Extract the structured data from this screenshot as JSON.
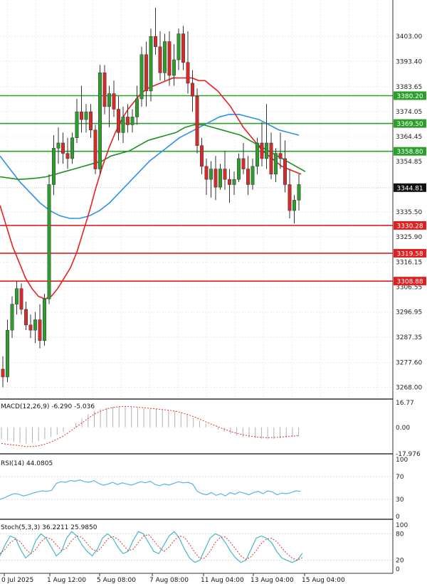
{
  "chart_data": {
    "type": "candlestick",
    "colors": {
      "bull": "#2e9d2e",
      "bear": "#d62b2b",
      "ma_red": "#e82020",
      "ma_green": "#1f8f1f",
      "ma_blue": "#2f8fe6",
      "support": "#e02020",
      "resistance": "#2aa02a",
      "macd_signal": "#e03030",
      "rsi_line": "#5ab0e8",
      "stoch_k": "#42b8c8",
      "stoch_d": "#e03030",
      "current_price": "#111111"
    },
    "price_axis": {
      "ticks": [
        "3403.00",
        "3393.40",
        "3383.65",
        "3374.05",
        "3364.45",
        "3354.85",
        "3335.50",
        "3325.90",
        "3316.15",
        "3306.55",
        "3296.95",
        "3287.35",
        "3277.60",
        "3268.00"
      ],
      "range": [
        3263.5,
        3417
      ]
    },
    "current_price": {
      "label": "3344.81",
      "value": 3344.81
    },
    "levels": [
      {
        "label": "3380.20",
        "value": 3380.2,
        "kind": "resistance"
      },
      {
        "label": "3369.50",
        "value": 3369.5,
        "kind": "resistance"
      },
      {
        "label": "3358.80",
        "value": 3358.8,
        "kind": "resistance"
      },
      {
        "label": "3330.28",
        "value": 3330.28,
        "kind": "support"
      },
      {
        "label": "3319.58",
        "value": 3319.58,
        "kind": "support"
      },
      {
        "label": "3308.88",
        "value": 3308.88,
        "kind": "support"
      }
    ],
    "x_labels": [
      "0 Jul 2025",
      "1 Aug 12:00",
      "5 Aug 08:00",
      "7 Aug 08:00",
      "11 Aug 04:00",
      "13 Aug 04:00",
      "15 Aug 04:00"
    ],
    "candles": [
      [
        3275,
        3280,
        3268,
        3272
      ],
      [
        3272,
        3294,
        3270,
        3290
      ],
      [
        3290,
        3303,
        3287,
        3300
      ],
      [
        3300,
        3309,
        3296,
        3306
      ],
      [
        3306,
        3308,
        3296,
        3298
      ],
      [
        3298,
        3301,
        3290,
        3292
      ],
      [
        3292,
        3296,
        3287,
        3290
      ],
      [
        3290,
        3297,
        3285,
        3294
      ],
      [
        3294,
        3300,
        3283,
        3286
      ],
      [
        3286,
        3304,
        3284,
        3302
      ],
      [
        3302,
        3350,
        3300,
        3346
      ],
      [
        3346,
        3365,
        3342,
        3360
      ],
      [
        3360,
        3368,
        3354,
        3362
      ],
      [
        3362,
        3366,
        3354,
        3358
      ],
      [
        3358,
        3364,
        3352,
        3356
      ],
      [
        3356,
        3366,
        3354,
        3364
      ],
      [
        3364,
        3379,
        3362,
        3374
      ],
      [
        3374,
        3384,
        3366,
        3371
      ],
      [
        3371,
        3377,
        3366,
        3374
      ],
      [
        3374,
        3377,
        3364,
        3367
      ],
      [
        3367,
        3369,
        3350,
        3352
      ],
      [
        3352,
        3392,
        3350,
        3389
      ],
      [
        3389,
        3392,
        3373,
        3376
      ],
      [
        3376,
        3384,
        3368,
        3381
      ],
      [
        3381,
        3386,
        3372,
        3375
      ],
      [
        3375,
        3380,
        3363,
        3366
      ],
      [
        3366,
        3376,
        3362,
        3372
      ],
      [
        3372,
        3377,
        3366,
        3369
      ],
      [
        3369,
        3375,
        3366,
        3372
      ],
      [
        3372,
        3384,
        3369,
        3379
      ],
      [
        3379,
        3399,
        3376,
        3396
      ],
      [
        3396,
        3401,
        3376,
        3382
      ],
      [
        3382,
        3406,
        3378,
        3403
      ],
      [
        3403,
        3414,
        3396,
        3399
      ],
      [
        3399,
        3405,
        3386,
        3389
      ],
      [
        3389,
        3404,
        3386,
        3401
      ],
      [
        3401,
        3405,
        3384,
        3388
      ],
      [
        3388,
        3400,
        3384,
        3394
      ],
      [
        3394,
        3406,
        3390,
        3404
      ],
      [
        3404,
        3407,
        3390,
        3393
      ],
      [
        3393,
        3405,
        3381,
        3385
      ],
      [
        3385,
        3390,
        3374,
        3380
      ],
      [
        3380,
        3383,
        3358,
        3361
      ],
      [
        3361,
        3364,
        3350,
        3353
      ],
      [
        3353,
        3356,
        3342,
        3348
      ],
      [
        3348,
        3355,
        3341,
        3352
      ],
      [
        3352,
        3357,
        3340,
        3345
      ],
      [
        3345,
        3354,
        3344,
        3352
      ],
      [
        3352,
        3359,
        3344,
        3348
      ],
      [
        3348,
        3352,
        3339,
        3346
      ],
      [
        3346,
        3351,
        3342,
        3348
      ],
      [
        3348,
        3358,
        3347,
        3356
      ],
      [
        3356,
        3362,
        3350,
        3352
      ],
      [
        3352,
        3357,
        3342,
        3346
      ],
      [
        3346,
        3356,
        3344,
        3353
      ],
      [
        3353,
        3364,
        3350,
        3362
      ],
      [
        3362,
        3370,
        3353,
        3356
      ],
      [
        3356,
        3377,
        3352,
        3362
      ],
      [
        3362,
        3366,
        3348,
        3350
      ],
      [
        3350,
        3360,
        3347,
        3358
      ],
      [
        3358,
        3366,
        3352,
        3356
      ],
      [
        3356,
        3363,
        3343,
        3346
      ],
      [
        3346,
        3352,
        3333,
        3336
      ],
      [
        3336,
        3342,
        3331,
        3340
      ],
      [
        3340,
        3350,
        3336,
        3346
      ]
    ],
    "moving_averages": {
      "red": [
        3338,
        3330,
        3322,
        3316,
        3310,
        3306,
        3303,
        3302,
        3303,
        3306,
        3310,
        3314,
        3320,
        3328,
        3336,
        3345,
        3353,
        3360,
        3366,
        3371,
        3375,
        3378,
        3381,
        3383,
        3384,
        3385,
        3386,
        3387,
        3387,
        3387,
        3387,
        3386,
        3386,
        3384,
        3382,
        3379,
        3376,
        3372,
        3368,
        3365,
        3362,
        3359,
        3357,
        3355,
        3353,
        3352,
        3351,
        3350
      ],
      "green": [
        3349,
        3348.5,
        3348,
        3348.2,
        3348.5,
        3349,
        3350,
        3351,
        3352,
        3353,
        3354,
        3355,
        3357,
        3358,
        3359,
        3361,
        3363,
        3364,
        3365,
        3366,
        3368,
        3369,
        3369,
        3368,
        3367,
        3366,
        3365,
        3363,
        3361,
        3359,
        3357,
        3355,
        3353,
        3351
      ],
      "blue": [
        3357,
        3352,
        3347,
        3343,
        3339,
        3336,
        3334,
        3333,
        3333,
        3334,
        3336,
        3339,
        3343,
        3347,
        3351,
        3355,
        3358,
        3361,
        3364,
        3366,
        3368,
        3370,
        3372,
        3373,
        3373,
        3372,
        3371,
        3369,
        3367,
        3366,
        3365
      ]
    },
    "macd": {
      "label": "MACD(12,26,9) -6.290 -5.036",
      "ticks": [
        "16.77",
        "0.00",
        "-17.976"
      ],
      "range": [
        -17.976,
        16.77
      ],
      "histogram": [
        -8,
        -9,
        -10,
        -10.5,
        -11,
        -10.5,
        -9.5,
        -8,
        -6.5,
        -5,
        -3,
        0,
        3,
        6,
        9,
        11,
        12.5,
        13.5,
        14,
        14.2,
        14,
        13.8,
        13.5,
        13.2,
        12.8,
        12.5,
        12,
        11.5,
        11,
        10,
        8.5,
        6.5,
        4.5,
        2.5,
        0.5,
        -1.5,
        -3,
        -4.5,
        -5.5,
        -6.5,
        -7,
        -7.5,
        -7.8,
        -8,
        -7.8,
        -7.5,
        -7,
        -6.5,
        -6.3
      ],
      "signal": [
        -11,
        -11.5,
        -12,
        -12.5,
        -13,
        -13,
        -12.5,
        -11.5,
        -10,
        -8,
        -6,
        -3,
        0,
        3,
        6,
        9,
        11,
        12.5,
        13.5,
        14,
        14.2,
        14,
        13.7,
        13.3,
        12.9,
        12.5,
        12.1,
        11.6,
        11,
        10,
        8.8,
        7.3,
        5.6,
        3.8,
        2,
        0.3,
        -1.3,
        -2.8,
        -4,
        -5,
        -5.8,
        -6.4,
        -6.8,
        -7,
        -6.9,
        -6.7,
        -6.3,
        -5.9,
        -5.6
      ]
    },
    "rsi": {
      "label": "RSI(14) 44.0805",
      "ticks": [
        "100",
        "70",
        "30",
        "0"
      ],
      "range": [
        0,
        100
      ],
      "values": [
        30,
        33,
        37,
        40,
        39,
        36,
        38,
        41,
        43,
        45,
        44,
        46,
        58,
        61,
        60,
        63,
        62,
        64,
        61,
        60,
        63,
        58,
        55,
        57,
        60,
        56,
        59,
        57,
        55,
        58,
        61,
        59,
        62,
        56,
        54,
        57,
        55,
        58,
        61,
        59,
        60,
        57,
        44,
        40,
        38,
        42,
        37,
        40,
        36,
        42,
        39,
        43,
        41,
        38,
        42,
        44,
        40,
        45,
        43,
        38,
        41,
        40,
        42,
        45,
        44
      ]
    },
    "stoch": {
      "label": "Stoch(5,3,3) 36.2211 25.9850",
      "ticks": [
        "100",
        "80",
        "20",
        "0"
      ],
      "range": [
        0,
        100
      ],
      "k": [
        30,
        55,
        75,
        70,
        45,
        25,
        35,
        65,
        80,
        70,
        50,
        30,
        40,
        70,
        85,
        75,
        55,
        40,
        30,
        45,
        70,
        80,
        70,
        50,
        35,
        40,
        65,
        85,
        80,
        60,
        40,
        35,
        55,
        75,
        85,
        70,
        45,
        25,
        15,
        20,
        45,
        70,
        80,
        75,
        60,
        40,
        25,
        15,
        20,
        45,
        70,
        75,
        70,
        60,
        40,
        25,
        20,
        15,
        20,
        36
      ],
      "d": [
        35,
        45,
        60,
        68,
        62,
        45,
        35,
        45,
        62,
        72,
        68,
        55,
        42,
        48,
        65,
        75,
        72,
        58,
        45,
        40,
        52,
        68,
        74,
        68,
        55,
        42,
        45,
        60,
        75,
        78,
        65,
        50,
        40,
        50,
        65,
        75,
        72,
        56,
        38,
        24,
        25,
        40,
        60,
        72,
        73,
        60,
        45,
        30,
        22,
        28,
        42,
        58,
        68,
        70,
        62,
        48,
        35,
        25,
        20,
        26
      ]
    }
  }
}
